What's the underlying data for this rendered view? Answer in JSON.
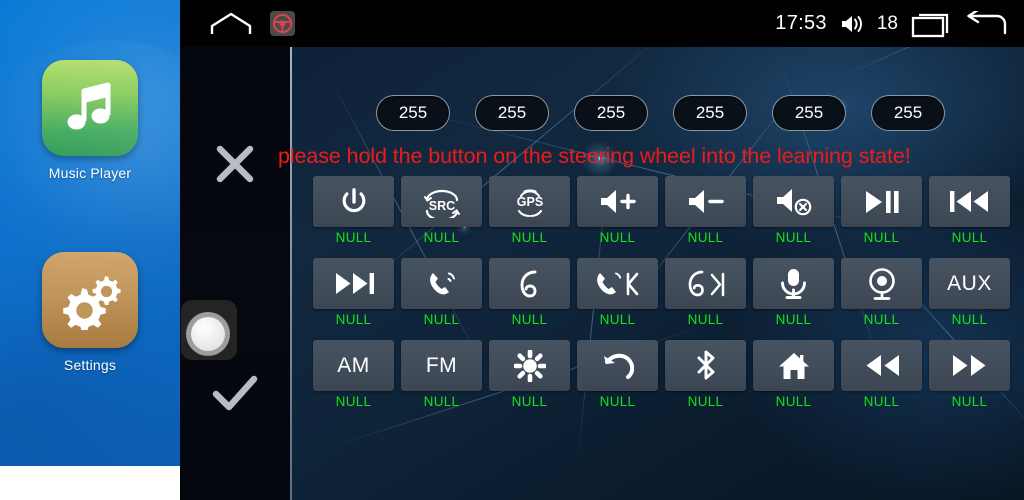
{
  "sidebar": {
    "apps": [
      {
        "icon": "music-note-icon",
        "label": "Music Player"
      },
      {
        "icon": "gears-icon",
        "label": "Settings"
      }
    ]
  },
  "statusbar": {
    "home_icon": "home-outline-icon",
    "wheel_icon": "steering-wheel-icon",
    "time": "17:53",
    "volume_icon": "volume-icon",
    "volume_value": "18",
    "recents_icon": "recents-icon",
    "back_icon": "back-arrow-icon"
  },
  "gutter": {
    "cancel_icon": "close-x-icon",
    "confirm_icon": "checkmark-icon",
    "pointer_icon": "orange-arrow-icon",
    "key_icon": "steering-key-button-icon"
  },
  "panel": {
    "warning_text": "please hold the button on the steering wheel into the learning state!",
    "warning_color": "#ee1b18",
    "label_color": "#18e019",
    "pills": [
      {
        "value": "255"
      },
      {
        "value": "255"
      },
      {
        "value": "255"
      },
      {
        "value": "255"
      },
      {
        "value": "255"
      },
      {
        "value": "255"
      }
    ],
    "rows": [
      [
        {
          "icon": "power-icon",
          "text": "",
          "label": "NULL"
        },
        {
          "icon": "src-icon",
          "text": "",
          "label": "NULL"
        },
        {
          "icon": "gps-icon",
          "text": "",
          "label": "NULL"
        },
        {
          "icon": "volume-up-icon",
          "text": "",
          "label": "NULL"
        },
        {
          "icon": "volume-down-icon",
          "text": "",
          "label": "NULL"
        },
        {
          "icon": "volume-mute-icon",
          "text": "",
          "label": "NULL"
        },
        {
          "icon": "play-pause-icon",
          "text": "",
          "label": "NULL"
        },
        {
          "icon": "previous-track-icon",
          "text": "",
          "label": "NULL"
        }
      ],
      [
        {
          "icon": "next-track-icon",
          "text": "",
          "label": "NULL"
        },
        {
          "icon": "call-answer-icon",
          "text": "",
          "label": "NULL"
        },
        {
          "icon": "call-hangup-icon",
          "text": "",
          "label": "NULL"
        },
        {
          "icon": "call-answer-k-icon",
          "text": "",
          "label": "NULL"
        },
        {
          "icon": "call-hangup-skip-icon",
          "text": "",
          "label": "NULL"
        },
        {
          "icon": "microphone-icon",
          "text": "",
          "label": "NULL"
        },
        {
          "icon": "camera-icon",
          "text": "",
          "label": "NULL"
        },
        {
          "icon": "",
          "text": "AUX",
          "label": "NULL"
        }
      ],
      [
        {
          "icon": "",
          "text": "AM",
          "label": "NULL"
        },
        {
          "icon": "",
          "text": "FM",
          "label": "NULL"
        },
        {
          "icon": "brightness-icon",
          "text": "",
          "label": "NULL"
        },
        {
          "icon": "back-curved-arrow-icon",
          "text": "",
          "label": "NULL"
        },
        {
          "icon": "bluetooth-icon",
          "text": "",
          "label": "NULL"
        },
        {
          "icon": "home-icon",
          "text": "",
          "label": "NULL"
        },
        {
          "icon": "rewind-icon",
          "text": "",
          "label": "NULL"
        },
        {
          "icon": "fast-forward-icon",
          "text": "",
          "label": "NULL"
        }
      ]
    ]
  }
}
